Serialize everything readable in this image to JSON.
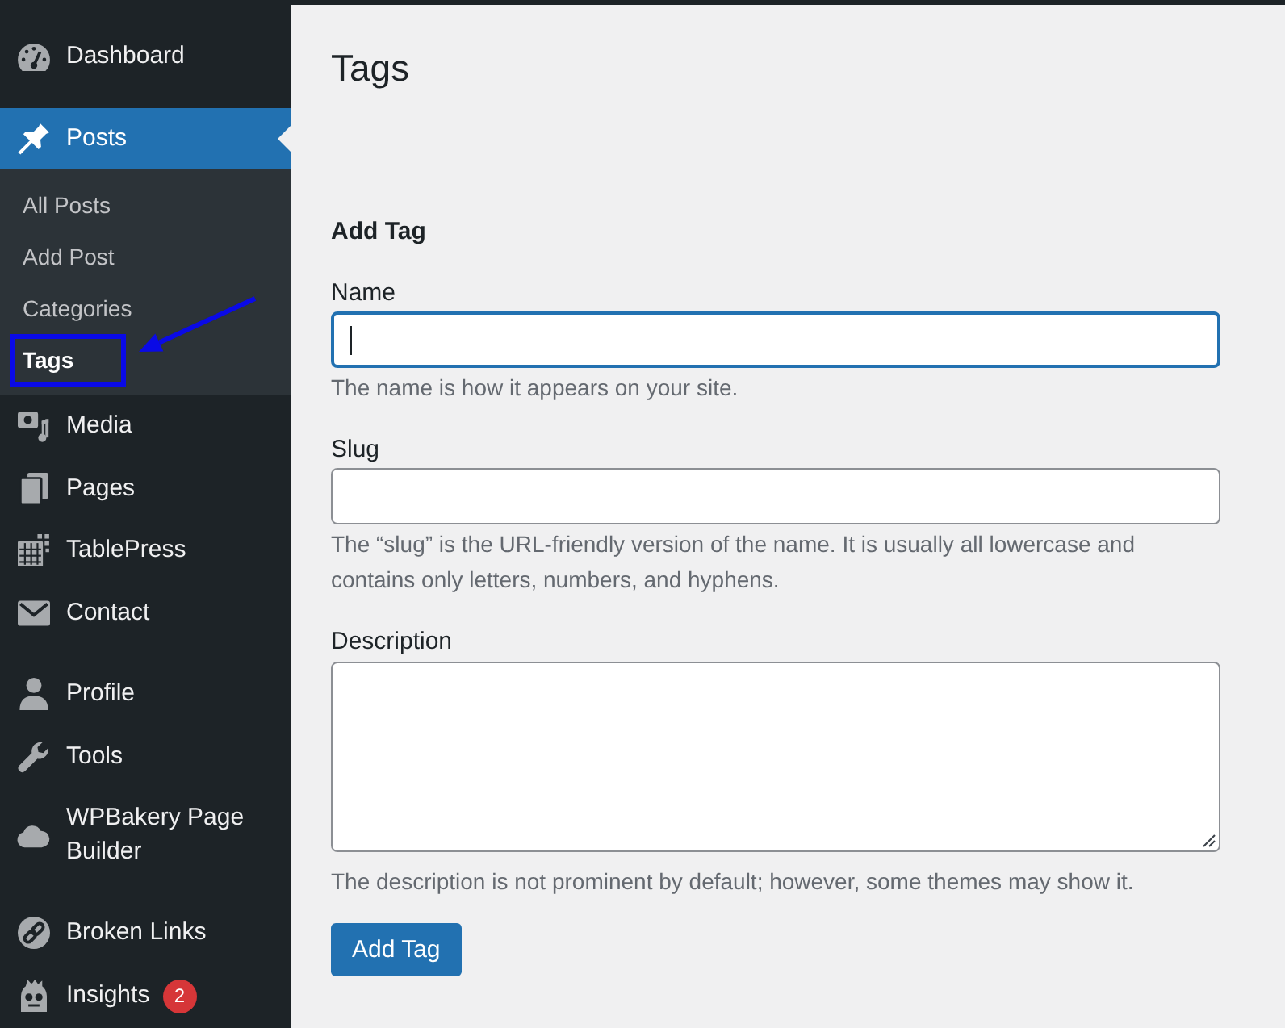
{
  "menu_groups": [
    {
      "items": [
        {
          "label": "Dashboard",
          "selected": false
        }
      ]
    },
    {
      "items": [
        {
          "label": "Posts",
          "selected": true,
          "children": [
            {
              "label": "All Posts",
              "selected": false,
              "highlighted": false
            },
            {
              "label": "Add Post",
              "selected": false,
              "highlighted": false
            },
            {
              "label": "Categories",
              "selected": false,
              "highlighted": false
            },
            {
              "label": "Tags",
              "selected": true,
              "highlighted": true
            }
          ]
        },
        {
          "label": "Media",
          "selected": false
        },
        {
          "label": "Pages",
          "selected": false
        },
        {
          "label": "TablePress",
          "selected": false
        },
        {
          "label": "Contact",
          "selected": false
        }
      ]
    },
    {
      "items": [
        {
          "label": "Profile",
          "selected": false
        },
        {
          "label": "Tools",
          "selected": false
        },
        {
          "label": "WPBakery Page Builder",
          "selected": false
        }
      ]
    },
    {
      "items": [
        {
          "label": "Broken Links",
          "selected": false
        },
        {
          "label": "Insights",
          "selected": false,
          "badge": "2"
        }
      ]
    }
  ],
  "page": {
    "title": "Tags"
  },
  "form": {
    "heading": "Add Tag",
    "fields": [
      {
        "kind": "text",
        "label": "Name",
        "focused": true,
        "help": "The name is how it appears on your site."
      },
      {
        "kind": "text",
        "label": "Slug",
        "focused": false,
        "help": "The “slug” is the URL-friendly version of the name. It is usually all lowercase and contains only letters, numbers, and hyphens."
      },
      {
        "kind": "textarea",
        "label": "Description",
        "focused": false,
        "help": "The description is not prominent by default; however, some themes may show it."
      }
    ],
    "submit": "Add Tag"
  }
}
